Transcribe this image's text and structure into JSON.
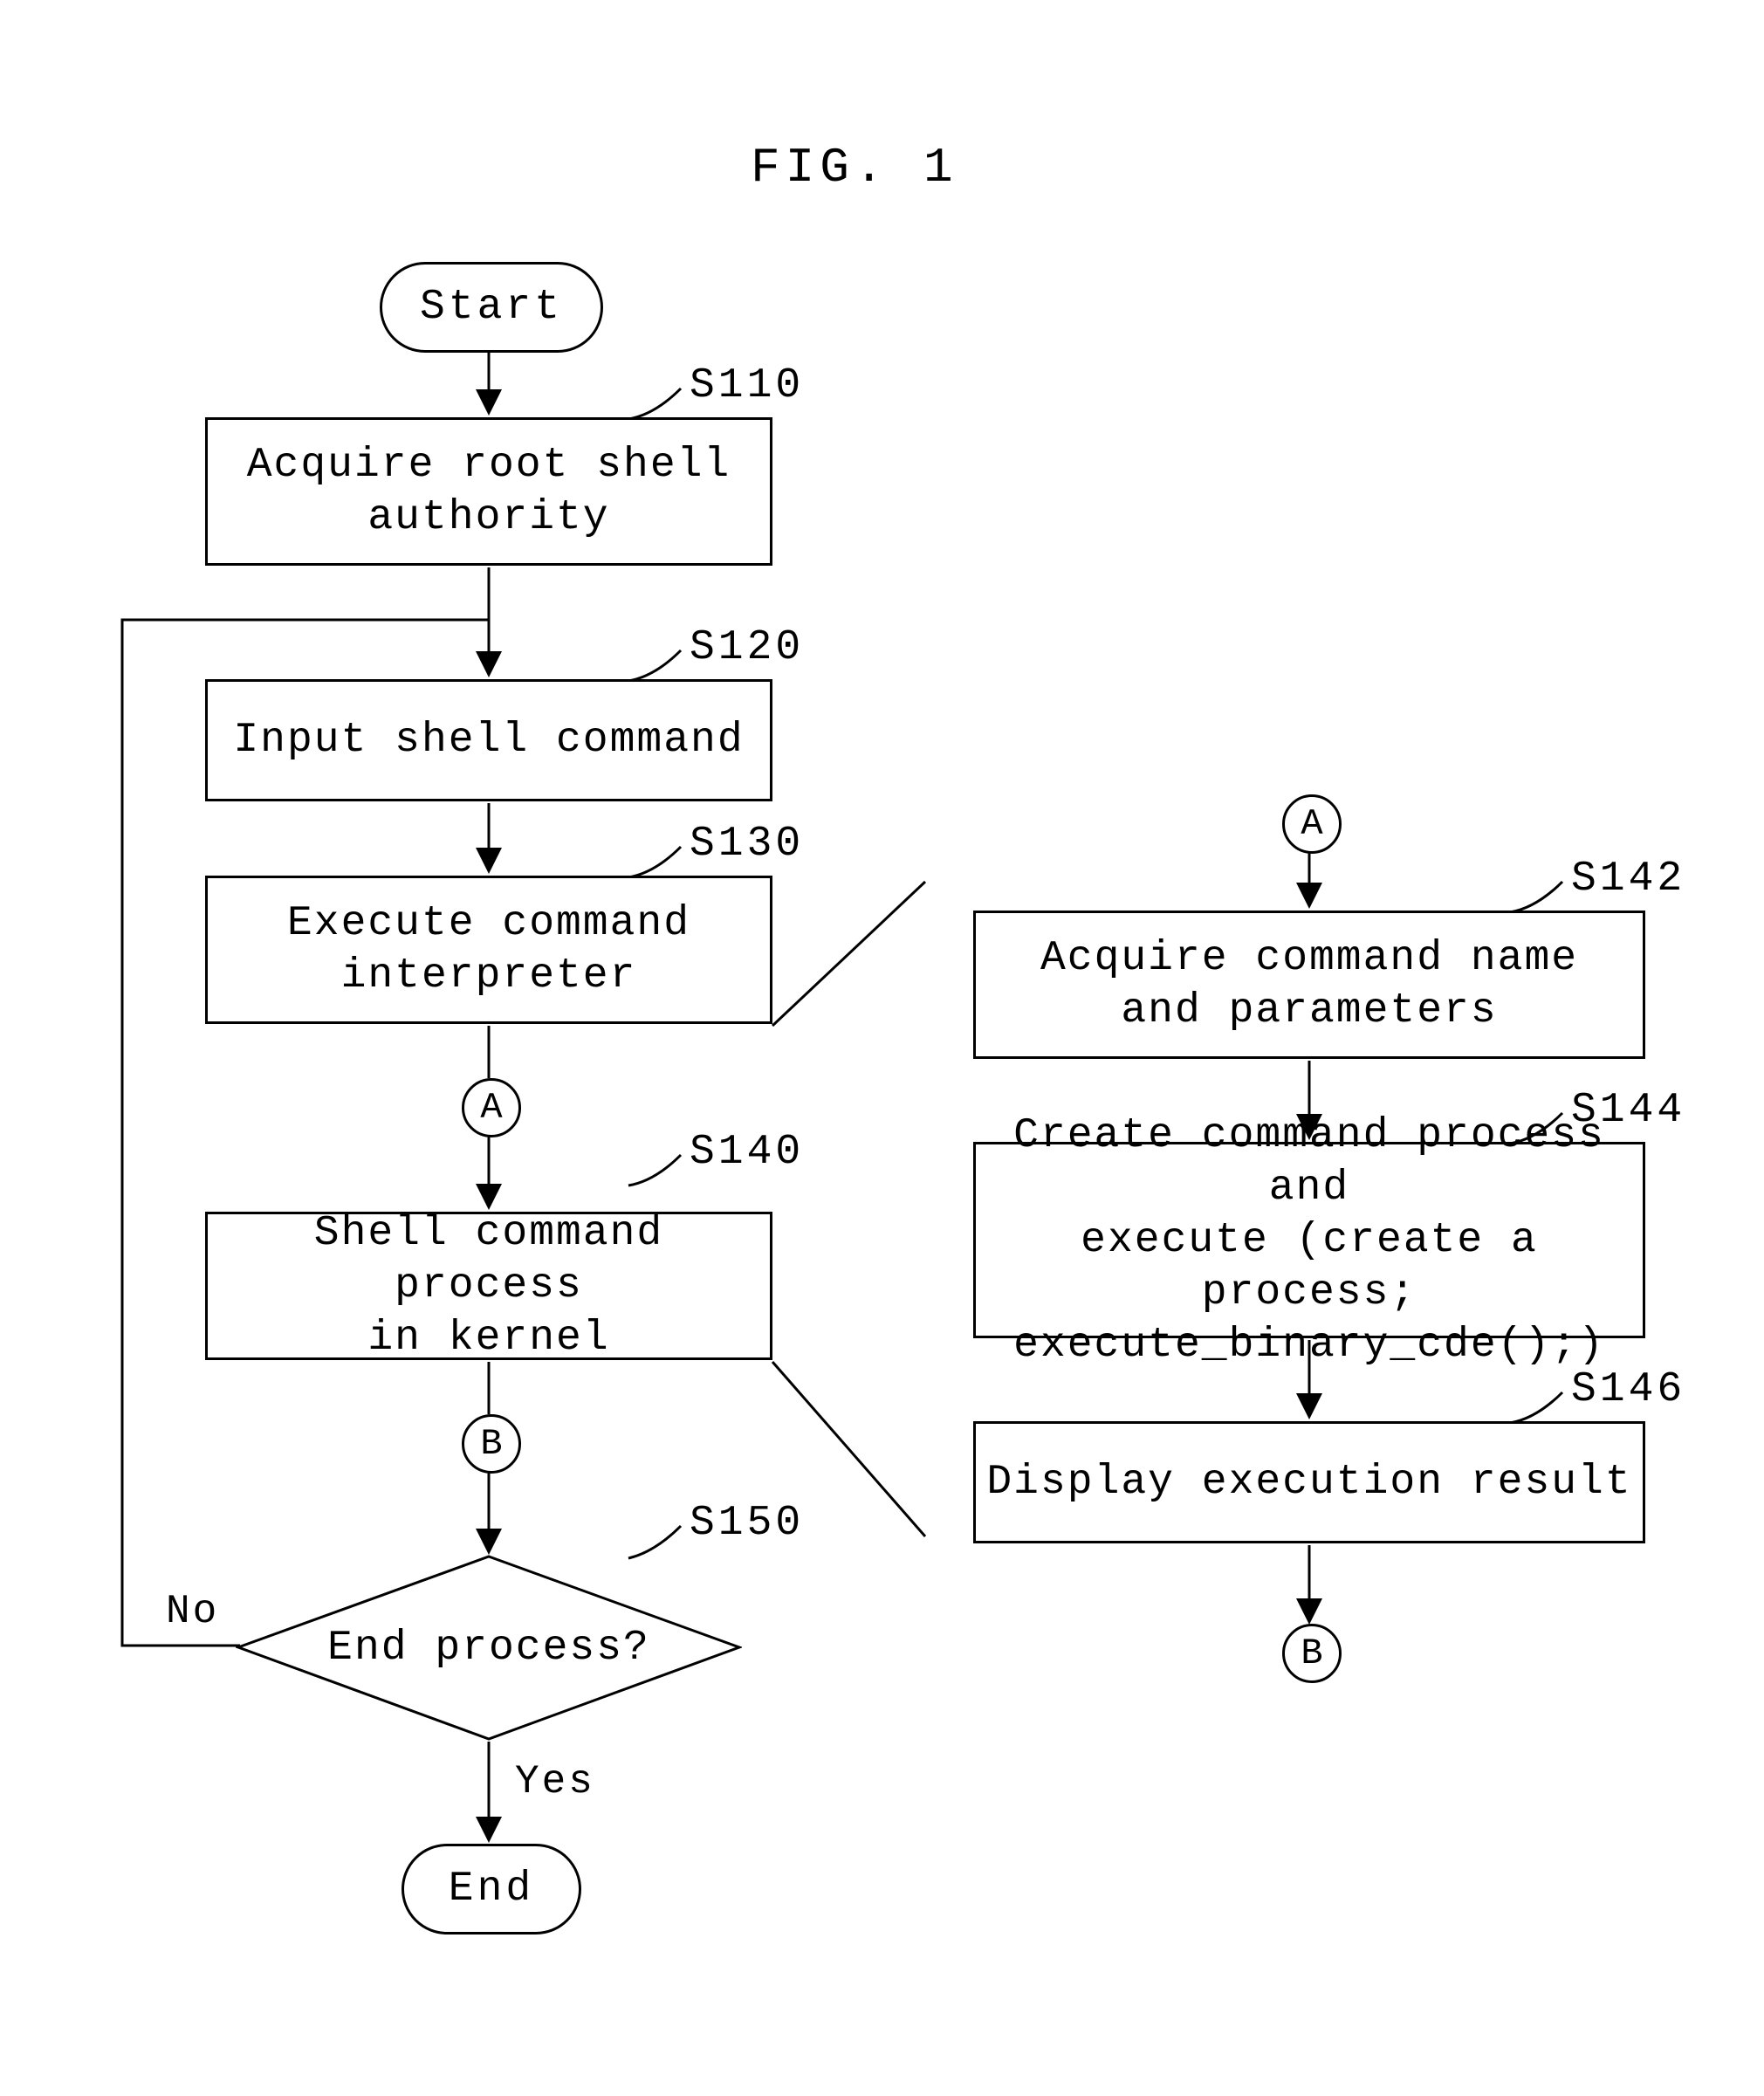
{
  "figure_title": "FIG. 1",
  "terminators": {
    "start": "Start",
    "end": "End"
  },
  "connectors": {
    "A": "A",
    "B": "B"
  },
  "decision": {
    "label": "End process?",
    "yes": "Yes",
    "no": "No",
    "step": "S150"
  },
  "steps": {
    "s110": {
      "id": "S110",
      "text": "Acquire root shell\nauthority"
    },
    "s120": {
      "id": "S120",
      "text": "Input shell command"
    },
    "s130": {
      "id": "S130",
      "text": "Execute command\ninterpreter"
    },
    "s140": {
      "id": "S140",
      "text": "Shell command process\nin kernel"
    },
    "s142": {
      "id": "S142",
      "text": "Acquire command name\nand parameters"
    },
    "s144": {
      "id": "S144",
      "text": "Create command process and\nexecute (create a process;\nexecute_binary_cde();)"
    },
    "s146": {
      "id": "S146",
      "text": "Display execution result"
    }
  }
}
